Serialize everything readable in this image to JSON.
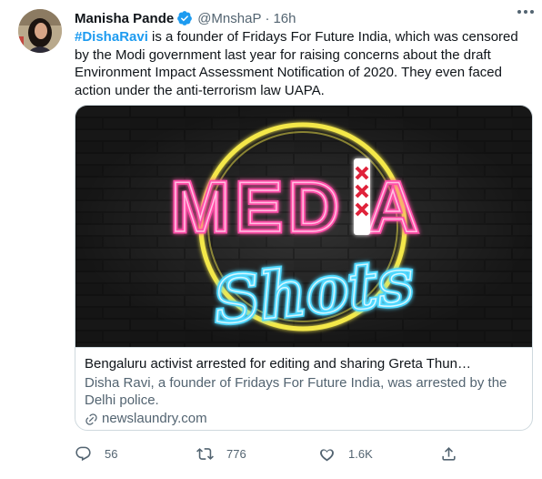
{
  "author": {
    "name": "Manisha Pande",
    "handle": "@MnshaP",
    "separator": "·",
    "time": "16h"
  },
  "tweet": {
    "hashtag": "#DishaRavi",
    "body": " is a founder of Fridays For Future India, which was censored by the Modi government last year for raising concerns about the draft Environment Impact Assessment Notification of 2020. They even faced action under the anti-terrorism law UAPA."
  },
  "card": {
    "image_logo_text": "MEDIA Shots",
    "title": "Bengaluru activist arrested for editing and sharing Greta Thun…",
    "description": "Disha Ravi, a founder of Fridays For Future India, was arrested by the Delhi police.",
    "domain": "newslaundry.com"
  },
  "actions": {
    "replies": "56",
    "retweets": "776",
    "likes": "1.6K"
  },
  "colors": {
    "accent": "#1d9bf0",
    "secondary_text": "#536471",
    "border": "#cfd9de",
    "neon_pink": "#ff4fa8",
    "neon_blue": "#4fd8ff",
    "neon_yellow": "#f4e84a"
  },
  "icons": [
    "verified-badge-icon",
    "more-icon",
    "link-icon",
    "reply-icon",
    "retweet-icon",
    "like-icon",
    "share-icon"
  ]
}
